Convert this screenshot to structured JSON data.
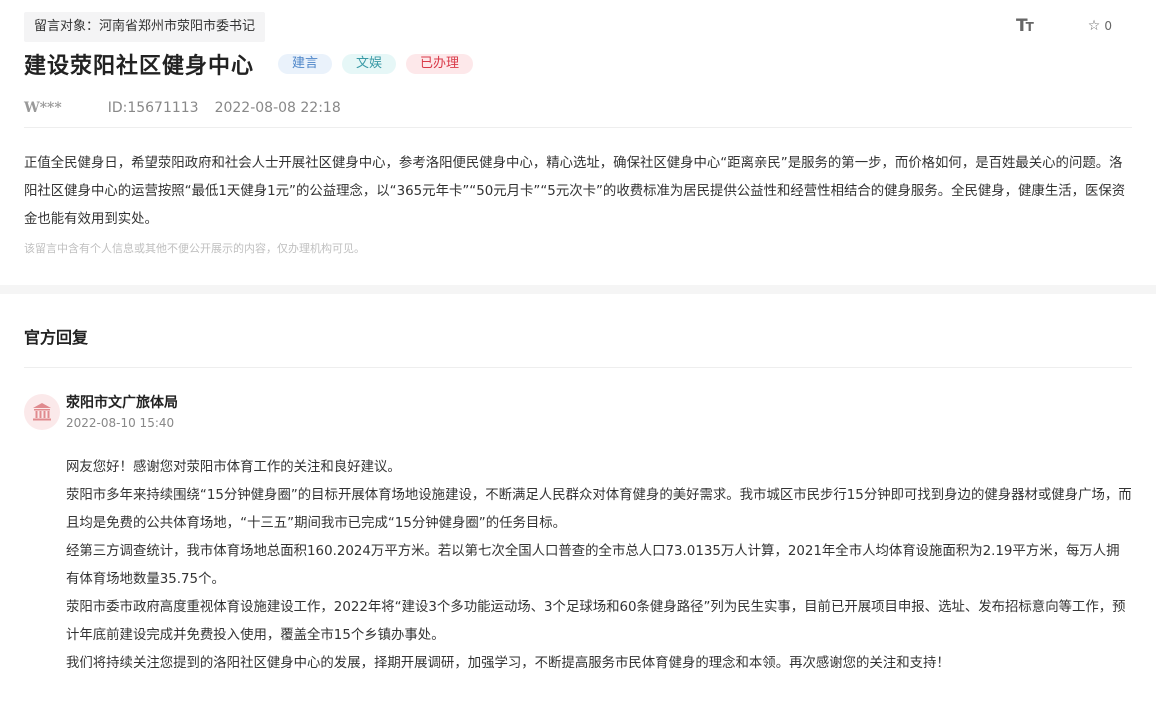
{
  "header": {
    "message_target": "留言对象：河南省郑州市荥阳市委书记",
    "title": "建设荥阳社区健身中心",
    "tags": [
      "建言",
      "文娱",
      "已办理"
    ],
    "author": "W***",
    "id": "ID:15671113",
    "datetime": "2022-08-08 22:18",
    "star_count": "0",
    "icons": {
      "font_size": "font-size-icon",
      "star": "star-icon"
    }
  },
  "message": {
    "content": "正值全民健身日，希望荥阳政府和社会人士开展社区健身中心，参考洛阳便民健身中心，精心选址，确保社区健身中心“距离亲民”是服务的第一步，而价格如何，是百姓最关心的问题。洛阳社区健身中心的运营按照“最低1天健身1元”的公益理念，以“365元年卡”“50元月卡”“5元次卡”的收费标准为居民提供公益性和经营性相结合的健身服务。全民健身，健康生活，医保资金也能有效用到实处。",
    "privacy_note": "该留言中含有个人信息或其他不便公开展示的内容，仅办理机构可见。"
  },
  "reply": {
    "section_title": "官方回复",
    "org_name": "荥阳市文广旅体局",
    "datetime": "2022-08-10 15:40",
    "paragraphs": [
      "网友您好！感谢您对荥阳市体育工作的关注和良好建议。",
      "荥阳市多年来持续围绕“15分钟健身圈”的目标开展体育场地设施建设，不断满足人民群众对体育健身的美好需求。我市城区市民步行15分钟即可找到身边的健身器材或健身广场，而且均是免费的公共体育场地，“十三五”期间我市已完成“15分钟健身圈”的任务目标。",
      "经第三方调查统计，我市体育场地总面积160.2024万平方米。若以第七次全国人口普查的全市总人口73.0135万人计算，2021年全市人均体育设施面积为2.19平方米，每万人拥有体育场地数量35.75个。",
      "荥阳市委市政府高度重视体育设施建设工作，2022年将“建设3个多功能运动场、3个足球场和60条健身路径”列为民生实事，目前已开展项目申报、选址、发布招标意向等工作，预计年底前建设完成并免费投入使用，覆盖全市15个乡镇办事处。",
      "我们将持续关注您提到的洛阳社区健身中心的发展，择期开展调研，加强学习，不断提高服务市民体育健身的理念和本领。再次感谢您的关注和支持！"
    ],
    "avatar_icon": "government-building-icon"
  }
}
